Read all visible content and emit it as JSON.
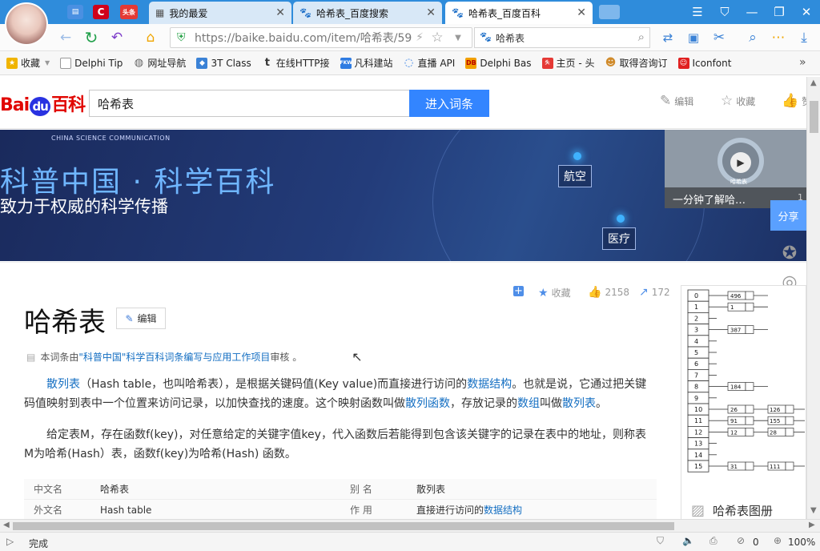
{
  "tabs": [
    {
      "label": "我的最爱",
      "active": false
    },
    {
      "label": "哈希表_百度搜索",
      "active": false
    },
    {
      "label": "哈希表_百度百科",
      "active": true
    }
  ],
  "mini_tabs": [
    "C",
    "头条"
  ],
  "url": "https://baike.baidu.com/item/哈希表/59",
  "search_box": "哈希表",
  "bookmarks": [
    "收藏",
    "Delphi Tip",
    "网址导航",
    "3T Class",
    "在线HTTP接",
    "凡科建站",
    "直播 API",
    "Delphi Bas",
    "主页 - 头",
    "取得咨询订",
    "Iconfont"
  ],
  "bookmark_icons": {
    "fk": "FKW",
    "db": "DB"
  },
  "logo": {
    "bai": "Bai",
    "du": "du",
    "baike": "百科"
  },
  "query": "哈希表",
  "query_button": "进入词条",
  "header_actions": [
    "编辑",
    "收藏",
    "赞"
  ],
  "banner": {
    "subtitle": "CHINA SCIENCE COMMUNICATION",
    "title": "科普中国 · 科学百科",
    "slogan": "致力于权威的科学传播",
    "tags": [
      "航空",
      "医疗"
    ],
    "video_caption": "一分钟了解哈…",
    "video_label": "哈希表",
    "video_count": "1"
  },
  "share_label": "分享",
  "meta": {
    "collect": "收藏",
    "likes": "2158",
    "shares": "172"
  },
  "title": "哈希表",
  "edit_label": "编辑",
  "audit": {
    "prefix": "本词条由",
    "org": "\"科普中国\"科学百科词条编写与应用工作项目",
    "suffix": " 审核 。"
  },
  "para1": {
    "link1": "散列表",
    "t1": "（Hash table，也叫哈希表），是根据关键码值(Key value)而直接进行访问的",
    "link2": "数据结构",
    "t2": "。也就是说，它通过把关键码值映射到表中一个位置来访问记录，以加快查找的速度。这个映射函数叫做",
    "link3": "散列函数",
    "t3": "，存放记录的",
    "link4": "数组",
    "t4": "叫做",
    "link5": "散列表",
    "t5": "。"
  },
  "para2": "给定表M，存在函数f(key)，对任意给定的关键字值key，代入函数后若能得到包含该关键字的记录在表中的地址，则称表M为哈希(Hash）表，函数f(key)为哈希(Hash) 函数。",
  "infobox": [
    {
      "k1": "中文名",
      "v1": "哈希表",
      "k2": "别    名",
      "v2": "散列表",
      "link": true
    },
    {
      "k1": "外文名",
      "v1": "Hash table",
      "k2": "作    用",
      "v2pre": "直接进行访问的",
      "v2": "数据结构",
      "link": true
    }
  ],
  "album_caption": "哈希表图册",
  "hash_diagram": {
    "indices": [
      "0",
      "1",
      "2",
      "3",
      "4",
      "5",
      "6",
      "7",
      "8",
      "9",
      "10",
      "11",
      "12",
      "13",
      "14",
      "15"
    ],
    "col1": {
      "0": "496",
      "1": "1",
      "3": "387",
      "8": "184",
      "10": "26",
      "11": "91",
      "12": "12",
      "15": "31"
    },
    "col2": {
      "10": "126",
      "11": "155",
      "12": "28",
      "15": "111"
    }
  },
  "status": {
    "text": "完成",
    "zoom": "100%",
    "count": "0"
  }
}
